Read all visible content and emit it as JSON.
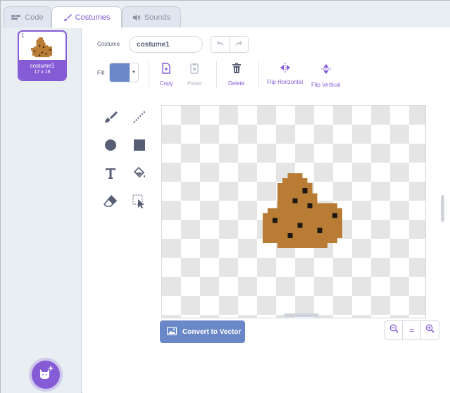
{
  "tabs": [
    {
      "label": "Code",
      "icon": "code-icon"
    },
    {
      "label": "Costumes",
      "icon": "brush-icon",
      "active": true
    },
    {
      "label": "Sounds",
      "icon": "speaker-icon"
    }
  ],
  "costume_list": {
    "selected": {
      "number": "1",
      "name": "costume1",
      "size": "17 x 16"
    },
    "add_button_icon": "add-costume-icon"
  },
  "editor": {
    "costume_label": "Costume",
    "costume_name": "costume1",
    "fill_label": "Fill",
    "fill_color": "#6a88c8",
    "actions": {
      "copy": "Copy",
      "paste": "Paste",
      "delete": "Delete",
      "flip_horizontal": "Flip Horizontal",
      "flip_vertical": "Flip Vertical"
    },
    "convert_label": "Convert to Vector",
    "zoom_reset": "="
  },
  "colors": {
    "accent": "#855cd6",
    "button_blue": "#6a88c8",
    "sprite_brown": "#b87c34",
    "chip_dark": "#1d1712"
  }
}
